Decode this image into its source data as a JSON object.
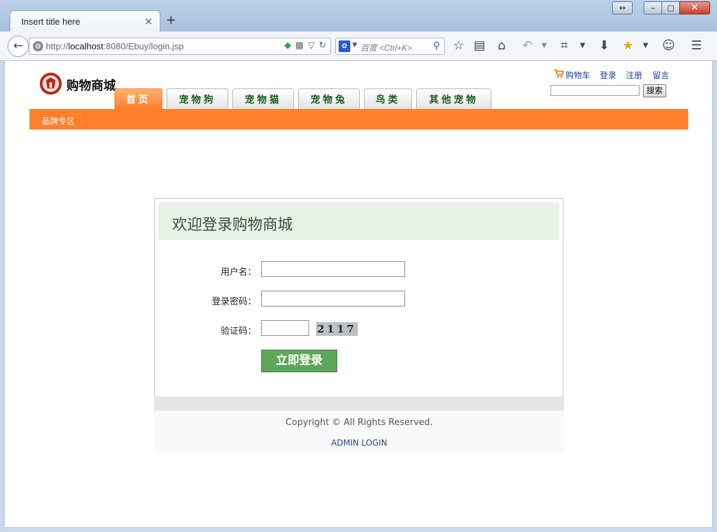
{
  "browser": {
    "tab_title": "Insert title here",
    "tab_close": "×",
    "new_tab": "+",
    "window_controls": {
      "resize": "⇔",
      "minimize": "‒",
      "maximize": "□",
      "close": "✕"
    },
    "url": {
      "scheme": "http://",
      "host": "localhost",
      "rest": ":8080/Ebuy/login.jsp"
    },
    "search_placeholder": "百度 <Ctrl+K>",
    "search_engine_icon": "baidu-paw-icon",
    "icons": [
      "bookmark-star-icon",
      "reader-list-icon",
      "home-icon",
      "undo-icon",
      "screenshot-crop-icon",
      "download-icon",
      "bookmark-manager-icon",
      "chat-icon",
      "menu-hamburger-icon"
    ]
  },
  "header": {
    "logo_text": "购物商城",
    "nav_tabs": [
      {
        "label": "首页",
        "active": true
      },
      {
        "label": "宠物狗",
        "active": false
      },
      {
        "label": "宠物猫",
        "active": false
      },
      {
        "label": "宠物兔",
        "active": false
      },
      {
        "label": "鸟类",
        "active": false
      },
      {
        "label": "其他宠物",
        "active": false
      }
    ],
    "brand_link": "品牌专区",
    "top_links": {
      "cart": "购物车",
      "login": "登录",
      "register": "注册",
      "message": "留言"
    },
    "search_button": "搜索",
    "accent_color": "#ff7f2a"
  },
  "login": {
    "title": "欢迎登录购物商城",
    "username_label": "用户名：",
    "username_value": "",
    "password_label": "登录密码：",
    "password_value": "",
    "captcha_label": "验证码：",
    "captcha_value": "",
    "captcha_image_text": "2117",
    "submit_label": "立即登录",
    "button_color": "#5ea65c"
  },
  "footer": {
    "copyright": "Copyright © All Rights Reserved.",
    "admin_link": "ADMIN LOGIN"
  }
}
